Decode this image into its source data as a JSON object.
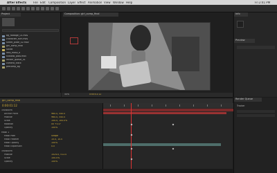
{
  "menubar": {
    "apple": "",
    "app_name": "After Effects",
    "items": [
      "File",
      "Edit",
      "Composition",
      "Layer",
      "Effect",
      "Animation",
      "View",
      "Window",
      "Help"
    ],
    "right_status": "Fri 2:41 PM"
  },
  "project": {
    "tab_label": "Project",
    "items": [
      {
        "name": "bg_footage_01.mov",
        "color": "#7a8fa8"
      },
      {
        "name": "character_turn.mov",
        "color": "#7a8fa8"
      },
      {
        "name": "street_plate_02.mov",
        "color": "#7a8fa8"
      },
      {
        "name": "girl_comp_final",
        "color": "#a7a06a"
      },
      {
        "name": "Solids",
        "color": "#c7b15c"
      },
      {
        "name": "roto_mask_a",
        "color": "#7a8fa8"
      },
      {
        "name": "shadow_pass.mov",
        "color": "#7a8fa8"
      },
      {
        "name": "render_queue_01",
        "color": "#a7a06a"
      },
      {
        "name": "camera_track",
        "color": "#7a8fa8"
      },
      {
        "name": "precomp_bg",
        "color": "#a7a06a"
      }
    ]
  },
  "viewer": {
    "tab_label": "Composition: girl_comp_final",
    "zoom": "50%",
    "timecode": "0:00:01:12"
  },
  "info_panel": {
    "tab_label": "Info",
    "preview_tab": "Preview"
  },
  "timeline": {
    "tab_label": "girl_comp_final",
    "timecode": "0:00:01:12",
    "layers": [
      {
        "name": "Transform",
        "value": "",
        "indent": 2
      },
      {
        "name": "Anchor Point",
        "value": "960.0, 540.0",
        "indent": 6
      },
      {
        "name": "Position",
        "value": "960.0, 540.0",
        "indent": 6
      },
      {
        "name": "Scale",
        "value": "100.0, 100.0%",
        "indent": 6
      },
      {
        "name": "Rotation",
        "value": "0x +0.0°",
        "indent": 6
      },
      {
        "name": "Opacity",
        "value": "100%",
        "indent": 6
      },
      {
        "name": "Mask 1",
        "value": "",
        "indent": 2
      },
      {
        "name": "Mask Path",
        "value": "Shape",
        "indent": 6
      },
      {
        "name": "Mask Feather",
        "value": "10.0, 10.0",
        "indent": 6
      },
      {
        "name": "Mask Opacity",
        "value": "100%",
        "indent": 6
      },
      {
        "name": "Mask Expansion",
        "value": "0.0",
        "indent": 6
      },
      {
        "name": "Transform",
        "value": "",
        "indent": 2
      },
      {
        "name": "Position",
        "value": "1024.0, 512.0",
        "indent": 6
      },
      {
        "name": "Scale",
        "value": "100.0%",
        "indent": 6
      },
      {
        "name": "Opacity",
        "value": "100%",
        "indent": 6
      }
    ]
  },
  "effects_panel": {
    "tab_label": "Render Queue",
    "sub_label": "Tracker"
  }
}
